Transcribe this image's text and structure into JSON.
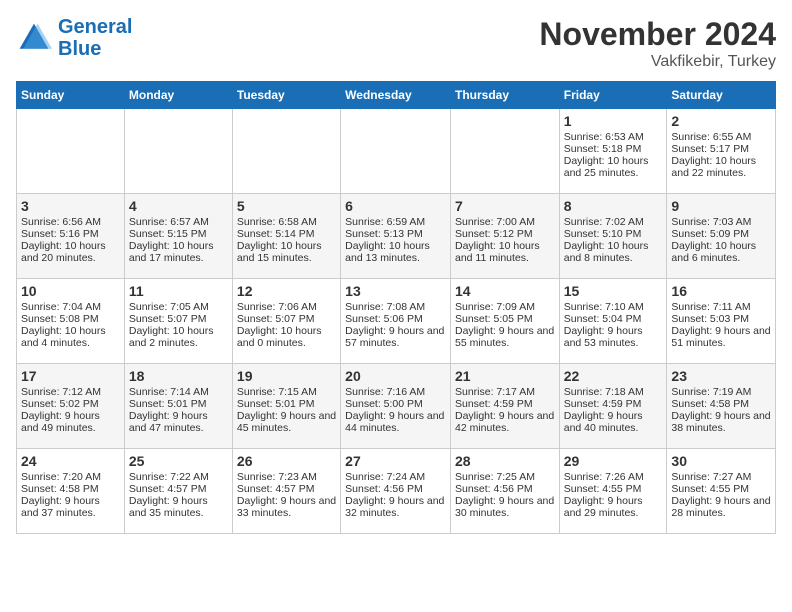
{
  "header": {
    "logo_line1": "General",
    "logo_line2": "Blue",
    "title": "November 2024",
    "subtitle": "Vakfikebir, Turkey"
  },
  "days_of_week": [
    "Sunday",
    "Monday",
    "Tuesday",
    "Wednesday",
    "Thursday",
    "Friday",
    "Saturday"
  ],
  "weeks": [
    [
      {
        "day": "",
        "content": ""
      },
      {
        "day": "",
        "content": ""
      },
      {
        "day": "",
        "content": ""
      },
      {
        "day": "",
        "content": ""
      },
      {
        "day": "",
        "content": ""
      },
      {
        "day": "1",
        "content": "Sunrise: 6:53 AM\nSunset: 5:18 PM\nDaylight: 10 hours and 25 minutes."
      },
      {
        "day": "2",
        "content": "Sunrise: 6:55 AM\nSunset: 5:17 PM\nDaylight: 10 hours and 22 minutes."
      }
    ],
    [
      {
        "day": "3",
        "content": "Sunrise: 6:56 AM\nSunset: 5:16 PM\nDaylight: 10 hours and 20 minutes."
      },
      {
        "day": "4",
        "content": "Sunrise: 6:57 AM\nSunset: 5:15 PM\nDaylight: 10 hours and 17 minutes."
      },
      {
        "day": "5",
        "content": "Sunrise: 6:58 AM\nSunset: 5:14 PM\nDaylight: 10 hours and 15 minutes."
      },
      {
        "day": "6",
        "content": "Sunrise: 6:59 AM\nSunset: 5:13 PM\nDaylight: 10 hours and 13 minutes."
      },
      {
        "day": "7",
        "content": "Sunrise: 7:00 AM\nSunset: 5:12 PM\nDaylight: 10 hours and 11 minutes."
      },
      {
        "day": "8",
        "content": "Sunrise: 7:02 AM\nSunset: 5:10 PM\nDaylight: 10 hours and 8 minutes."
      },
      {
        "day": "9",
        "content": "Sunrise: 7:03 AM\nSunset: 5:09 PM\nDaylight: 10 hours and 6 minutes."
      }
    ],
    [
      {
        "day": "10",
        "content": "Sunrise: 7:04 AM\nSunset: 5:08 PM\nDaylight: 10 hours and 4 minutes."
      },
      {
        "day": "11",
        "content": "Sunrise: 7:05 AM\nSunset: 5:07 PM\nDaylight: 10 hours and 2 minutes."
      },
      {
        "day": "12",
        "content": "Sunrise: 7:06 AM\nSunset: 5:07 PM\nDaylight: 10 hours and 0 minutes."
      },
      {
        "day": "13",
        "content": "Sunrise: 7:08 AM\nSunset: 5:06 PM\nDaylight: 9 hours and 57 minutes."
      },
      {
        "day": "14",
        "content": "Sunrise: 7:09 AM\nSunset: 5:05 PM\nDaylight: 9 hours and 55 minutes."
      },
      {
        "day": "15",
        "content": "Sunrise: 7:10 AM\nSunset: 5:04 PM\nDaylight: 9 hours and 53 minutes."
      },
      {
        "day": "16",
        "content": "Sunrise: 7:11 AM\nSunset: 5:03 PM\nDaylight: 9 hours and 51 minutes."
      }
    ],
    [
      {
        "day": "17",
        "content": "Sunrise: 7:12 AM\nSunset: 5:02 PM\nDaylight: 9 hours and 49 minutes."
      },
      {
        "day": "18",
        "content": "Sunrise: 7:14 AM\nSunset: 5:01 PM\nDaylight: 9 hours and 47 minutes."
      },
      {
        "day": "19",
        "content": "Sunrise: 7:15 AM\nSunset: 5:01 PM\nDaylight: 9 hours and 45 minutes."
      },
      {
        "day": "20",
        "content": "Sunrise: 7:16 AM\nSunset: 5:00 PM\nDaylight: 9 hours and 44 minutes."
      },
      {
        "day": "21",
        "content": "Sunrise: 7:17 AM\nSunset: 4:59 PM\nDaylight: 9 hours and 42 minutes."
      },
      {
        "day": "22",
        "content": "Sunrise: 7:18 AM\nSunset: 4:59 PM\nDaylight: 9 hours and 40 minutes."
      },
      {
        "day": "23",
        "content": "Sunrise: 7:19 AM\nSunset: 4:58 PM\nDaylight: 9 hours and 38 minutes."
      }
    ],
    [
      {
        "day": "24",
        "content": "Sunrise: 7:20 AM\nSunset: 4:58 PM\nDaylight: 9 hours and 37 minutes."
      },
      {
        "day": "25",
        "content": "Sunrise: 7:22 AM\nSunset: 4:57 PM\nDaylight: 9 hours and 35 minutes."
      },
      {
        "day": "26",
        "content": "Sunrise: 7:23 AM\nSunset: 4:57 PM\nDaylight: 9 hours and 33 minutes."
      },
      {
        "day": "27",
        "content": "Sunrise: 7:24 AM\nSunset: 4:56 PM\nDaylight: 9 hours and 32 minutes."
      },
      {
        "day": "28",
        "content": "Sunrise: 7:25 AM\nSunset: 4:56 PM\nDaylight: 9 hours and 30 minutes."
      },
      {
        "day": "29",
        "content": "Sunrise: 7:26 AM\nSunset: 4:55 PM\nDaylight: 9 hours and 29 minutes."
      },
      {
        "day": "30",
        "content": "Sunrise: 7:27 AM\nSunset: 4:55 PM\nDaylight: 9 hours and 28 minutes."
      }
    ]
  ]
}
